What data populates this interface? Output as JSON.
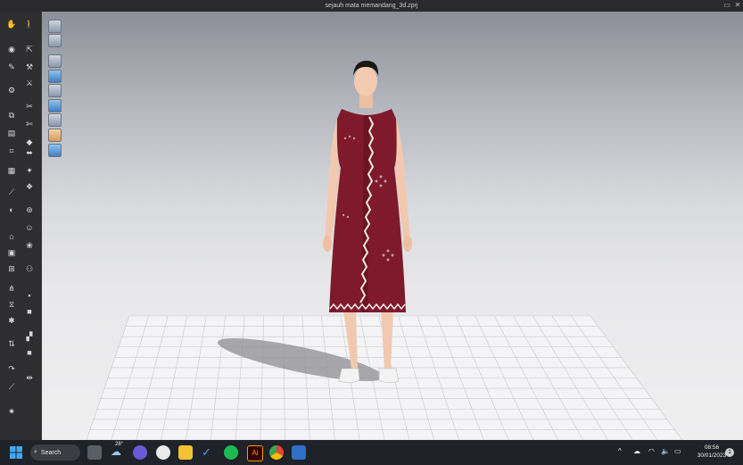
{
  "window": {
    "title": "sejauh mata memandang_3d.zprj"
  },
  "toolbar": {
    "icons": [
      "hand-icon",
      "pose-icon",
      "eye-icon",
      "select-icon",
      "transform-icon",
      "pin-icon",
      "needle-icon",
      "fold-icon",
      "cut-icon",
      "sew-icon",
      "measure-icon",
      "tape-icon",
      "button-icon",
      "zip-icon",
      "avatar-icon",
      "fabric-icon",
      "brush-icon",
      "stitch-icon",
      "pattern-icon",
      "layer-icon"
    ]
  },
  "viewport": {
    "tools": [
      "display-avatar-icon",
      "display-garment-icon",
      "shaded-icon",
      "texture-icon",
      "thickness-icon",
      "render-icon",
      "lighting-icon",
      "skin-icon",
      "world-icon"
    ],
    "garment_color": "#7e1a2c",
    "trim_color": "#f2e9e3"
  },
  "taskbar": {
    "search_label": "Search",
    "weather_temp": "28°",
    "time": "08:56",
    "date": "30/01/2023",
    "notification_count": "1",
    "apps": [
      "windows-start-icon",
      "task-view-icon",
      "weather-icon",
      "meet-icon",
      "clock-icon",
      "file-explorer-icon",
      "pin-app-icon",
      "spotify-icon",
      "illustrator-icon",
      "chrome-icon",
      "clo3d-icon"
    ]
  }
}
